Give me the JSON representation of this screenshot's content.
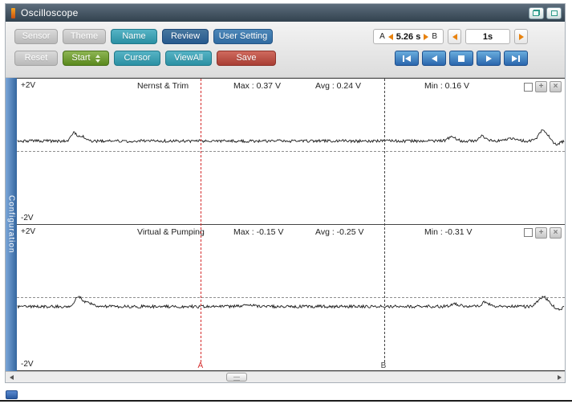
{
  "window": {
    "title": "Oscilloscope"
  },
  "toolbar": {
    "row1": {
      "sensor": "Sensor",
      "theme": "Theme",
      "name": "Name",
      "review": "Review",
      "user_setting": "User Setting"
    },
    "row2": {
      "reset": "Reset",
      "start": "Start",
      "cursor": "Cursor",
      "view_all": "ViewAll",
      "save": "Save"
    },
    "ab_readout": {
      "a": "A",
      "value": "5.26 s",
      "b": "B"
    },
    "timebase": "1s"
  },
  "sidebar": {
    "tab": "Configuration"
  },
  "icons": {
    "move_glyph": "+",
    "close_glyph": "×"
  },
  "colors": {
    "wave": "#1b1b1b",
    "cursor_a": "#d42a2a",
    "cursor_b": "#444444",
    "accent_orange": "#e8820e"
  },
  "cursors": {
    "a": {
      "label": "A",
      "x_frac": 0.336
    },
    "b": {
      "label": "B",
      "x_frac": 0.67
    }
  },
  "panels": [
    {
      "top_label": "+2V",
      "bottom_label": "-2V",
      "title": "Nernst & Trim",
      "max": "Max : 0.37 V",
      "avg": "Avg : 0.24 V",
      "min": "Min : 0.16 V",
      "waveform": {
        "baseline": 0.43,
        "noise": 0.01,
        "seed": 101,
        "bumps": [
          {
            "pos": 0.103,
            "h": 0.055,
            "w": 0.005
          },
          {
            "pos": 0.118,
            "h": 0.034,
            "w": 0.006
          },
          {
            "pos": 0.795,
            "h": 0.028,
            "w": 0.007
          },
          {
            "pos": 0.85,
            "h": 0.036,
            "w": 0.006
          },
          {
            "pos": 0.905,
            "h": 0.02,
            "w": 0.01
          },
          {
            "pos": 0.962,
            "h": 0.075,
            "w": 0.008
          },
          {
            "pos": 0.986,
            "h": -0.024,
            "w": 0.006
          }
        ]
      }
    },
    {
      "top_label": "+2V",
      "bottom_label": "-2V",
      "title": "Virtual & Pumping",
      "max": "Max : -0.15 V",
      "avg": "Avg : -0.25 V",
      "min": "Min : -0.31 V",
      "waveform": {
        "baseline": 0.56,
        "noise": 0.01,
        "seed": 202,
        "bumps": [
          {
            "pos": 0.112,
            "h": 0.07,
            "w": 0.007
          },
          {
            "pos": 0.131,
            "h": 0.024,
            "w": 0.006
          },
          {
            "pos": 0.42,
            "h": 0.012,
            "w": 0.01
          },
          {
            "pos": 0.8,
            "h": 0.018,
            "w": 0.008
          },
          {
            "pos": 0.856,
            "h": 0.03,
            "w": 0.006
          },
          {
            "pos": 0.962,
            "h": 0.065,
            "w": 0.009
          },
          {
            "pos": 0.99,
            "h": -0.02,
            "w": 0.006
          }
        ]
      }
    }
  ]
}
